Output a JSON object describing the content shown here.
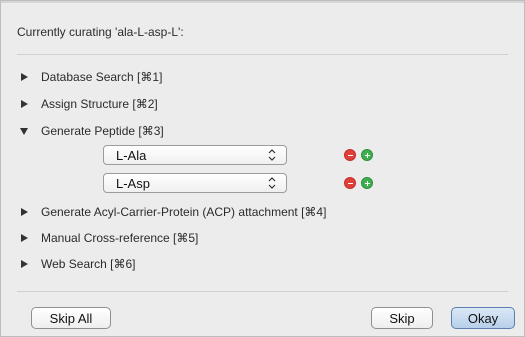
{
  "header": {
    "text": "Currently curating 'ala-L-asp-L':"
  },
  "sections": [
    {
      "label": "Database Search [⌘1]",
      "expanded": false
    },
    {
      "label": "Assign Structure [⌘2]",
      "expanded": false
    },
    {
      "label": "Generate Peptide [⌘3]",
      "expanded": true
    },
    {
      "label": "Generate Acyl-Carrier-Protein (ACP) attachment [⌘4]",
      "expanded": false
    },
    {
      "label": "Manual Cross-reference [⌘5]",
      "expanded": false
    },
    {
      "label": "Web Search [⌘6]",
      "expanded": false
    }
  ],
  "peptide": {
    "selects": [
      {
        "value": "L-Ala"
      },
      {
        "value": "L-Asp"
      }
    ]
  },
  "buttons": {
    "skip_all": "Skip All",
    "skip": "Skip",
    "okay": "Okay"
  },
  "colors": {
    "remove": "#e0403a",
    "add": "#3eae4e",
    "primary_button": "#b7cfea"
  },
  "icons": {
    "collapsed": "disclosure-triangle-right-icon",
    "expanded": "disclosure-triangle-down-icon",
    "remove": "remove-icon",
    "add": "add-icon",
    "select_arrows": "select-arrows-icon"
  }
}
